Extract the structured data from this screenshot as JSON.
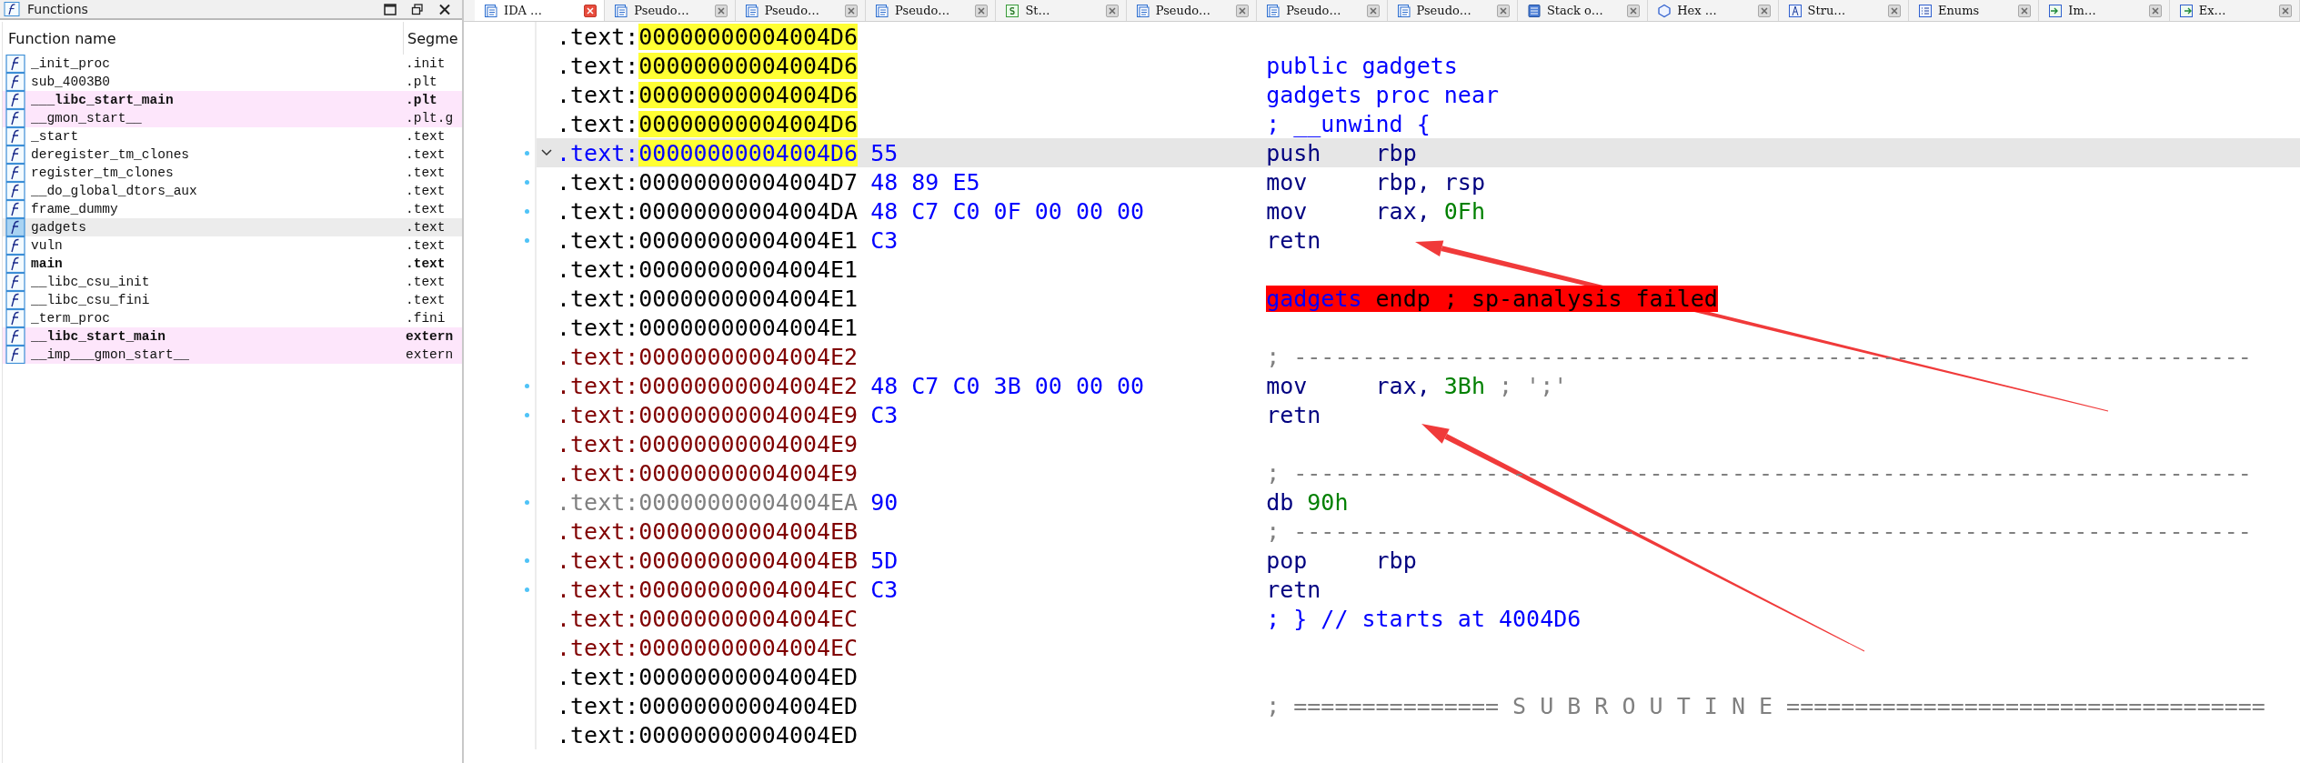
{
  "functions_panel": {
    "title": "Functions",
    "columns": [
      "Function name",
      "Segme"
    ],
    "rows": [
      {
        "name": "_init_proc",
        "segment": ".init",
        "bold": false,
        "library": false,
        "selected": false
      },
      {
        "name": "sub_4003B0",
        "segment": ".plt",
        "bold": false,
        "library": false,
        "selected": false
      },
      {
        "name": "___libc_start_main",
        "segment": ".plt",
        "bold": true,
        "library": true,
        "selected": false
      },
      {
        "name": "__gmon_start__",
        "segment": ".plt.g",
        "bold": false,
        "library": true,
        "selected": false
      },
      {
        "name": "_start",
        "segment": ".text",
        "bold": false,
        "library": false,
        "selected": false
      },
      {
        "name": "deregister_tm_clones",
        "segment": ".text",
        "bold": false,
        "library": false,
        "selected": false
      },
      {
        "name": "register_tm_clones",
        "segment": ".text",
        "bold": false,
        "library": false,
        "selected": false
      },
      {
        "name": "__do_global_dtors_aux",
        "segment": ".text",
        "bold": false,
        "library": false,
        "selected": false
      },
      {
        "name": "frame_dummy",
        "segment": ".text",
        "bold": false,
        "library": false,
        "selected": false
      },
      {
        "name": "gadgets",
        "segment": ".text",
        "bold": false,
        "library": false,
        "selected": true
      },
      {
        "name": "vuln",
        "segment": ".text",
        "bold": false,
        "library": false,
        "selected": false
      },
      {
        "name": "main",
        "segment": ".text",
        "bold": true,
        "library": false,
        "selected": false
      },
      {
        "name": "__libc_csu_init",
        "segment": ".text",
        "bold": false,
        "library": false,
        "selected": false
      },
      {
        "name": "__libc_csu_fini",
        "segment": ".text",
        "bold": false,
        "library": false,
        "selected": false
      },
      {
        "name": "_term_proc",
        "segment": ".fini",
        "bold": false,
        "library": false,
        "selected": false
      },
      {
        "name": "__libc_start_main",
        "segment": "extern",
        "bold": true,
        "library": true,
        "selected": false
      },
      {
        "name": "__imp___gmon_start__",
        "segment": "extern",
        "bold": false,
        "library": true,
        "selected": false
      }
    ]
  },
  "tabs": [
    {
      "label": "IDA …",
      "kind": "disasm",
      "selected": true
    },
    {
      "label": "Pseudo…",
      "kind": "pseudo",
      "selected": false
    },
    {
      "label": "Pseudo…",
      "kind": "pseudo",
      "selected": false
    },
    {
      "label": "Pseudo…",
      "kind": "pseudo",
      "selected": false
    },
    {
      "label": "St…",
      "kind": "strings",
      "selected": false
    },
    {
      "label": "Pseudo…",
      "kind": "pseudo",
      "selected": false
    },
    {
      "label": "Pseudo…",
      "kind": "pseudo",
      "selected": false
    },
    {
      "label": "Pseudo…",
      "kind": "pseudo",
      "selected": false
    },
    {
      "label": "Stack o…",
      "kind": "stack",
      "selected": false
    },
    {
      "label": "Hex …",
      "kind": "hex",
      "selected": false
    },
    {
      "label": "Stru…",
      "kind": "struct",
      "selected": false
    },
    {
      "label": "Enums",
      "kind": "enum",
      "selected": false
    },
    {
      "label": "Im…",
      "kind": "import",
      "selected": false
    },
    {
      "label": "Ex…",
      "kind": "export",
      "selected": false
    }
  ],
  "listing": [
    {
      "segment": ".text:",
      "address": "00000000004004D6",
      "kind": "function",
      "highlight": true,
      "current": false,
      "marked": false,
      "collapsible": false
    },
    {
      "segment": ".text:",
      "address": "00000000004004D6",
      "kind": "function",
      "highlight": true,
      "current": false,
      "marked": false,
      "collapsible": false,
      "code": {
        "tokens": [
          {
            "text": "public gadgets",
            "kind": "name"
          }
        ]
      }
    },
    {
      "segment": ".text:",
      "address": "00000000004004D6",
      "kind": "function",
      "highlight": true,
      "current": false,
      "marked": false,
      "collapsible": false,
      "code": {
        "tokens": [
          {
            "text": "gadgets proc near",
            "kind": "name"
          }
        ]
      }
    },
    {
      "segment": ".text:",
      "address": "00000000004004D6",
      "kind": "function",
      "highlight": true,
      "current": false,
      "marked": false,
      "collapsible": false,
      "code": {
        "tokens": [
          {
            "text": "; __unwind {",
            "kind": "name"
          }
        ]
      }
    },
    {
      "segment": ".text:",
      "address": "00000000004004D6",
      "kind": "function",
      "highlight": true,
      "current": true,
      "marked": true,
      "collapsible": true,
      "bytes": "55",
      "code": {
        "mnemonic": "push",
        "tokens": [
          {
            "text": "rbp",
            "kind": "operand"
          }
        ]
      }
    },
    {
      "segment": ".text:",
      "address": "00000000004004D7",
      "kind": "function",
      "highlight": false,
      "current": false,
      "marked": true,
      "collapsible": false,
      "bytes": "48 89 E5",
      "code": {
        "mnemonic": "mov",
        "tokens": [
          {
            "text": "rbp, rsp",
            "kind": "operand"
          }
        ]
      }
    },
    {
      "segment": ".text:",
      "address": "00000000004004DA",
      "kind": "function",
      "highlight": false,
      "current": false,
      "marked": true,
      "collapsible": false,
      "bytes": "48 C7 C0 0F 00 00 00",
      "code": {
        "mnemonic": "mov",
        "tokens": [
          {
            "text": "rax, ",
            "kind": "operand"
          },
          {
            "text": "0Fh",
            "kind": "number"
          }
        ]
      }
    },
    {
      "segment": ".text:",
      "address": "00000000004004E1",
      "kind": "function",
      "highlight": false,
      "current": false,
      "marked": true,
      "collapsible": false,
      "bytes": "C3",
      "code": {
        "mnemonic": "retn"
      }
    },
    {
      "segment": ".text:",
      "address": "00000000004004E1",
      "kind": "function",
      "highlight": false,
      "current": false,
      "marked": false,
      "collapsible": false
    },
    {
      "segment": ".text:",
      "address": "00000000004004E1",
      "kind": "function",
      "highlight": false,
      "current": false,
      "marked": false,
      "collapsible": false,
      "code": {
        "error": true,
        "tokens": [
          {
            "text": "gadgets",
            "kind": "name"
          },
          {
            "text": " endp ; sp-analysis failed",
            "kind": "plain"
          }
        ]
      }
    },
    {
      "segment": ".text:",
      "address": "00000000004004E1",
      "kind": "function",
      "highlight": false,
      "current": false,
      "marked": false,
      "collapsible": false
    },
    {
      "segment": ".text:",
      "address": "00000000004004E2",
      "kind": "outside",
      "highlight": false,
      "current": false,
      "marked": false,
      "collapsible": false,
      "code": {
        "tokens": [
          {
            "text": "; ----------------------------------------------------------------------",
            "kind": "comment"
          }
        ]
      }
    },
    {
      "segment": ".text:",
      "address": "00000000004004E2",
      "kind": "outside",
      "highlight": false,
      "current": false,
      "marked": true,
      "collapsible": false,
      "bytes": "48 C7 C0 3B 00 00 00",
      "code": {
        "mnemonic": "mov",
        "tokens": [
          {
            "text": "rax, ",
            "kind": "operand"
          },
          {
            "text": "3Bh",
            "kind": "number"
          },
          {
            "text": " ; ';'",
            "kind": "comment"
          }
        ]
      }
    },
    {
      "segment": ".text:",
      "address": "00000000004004E9",
      "kind": "outside",
      "highlight": false,
      "current": false,
      "marked": true,
      "collapsible": false,
      "bytes": "C3",
      "code": {
        "mnemonic": "retn"
      }
    },
    {
      "segment": ".text:",
      "address": "00000000004004E9",
      "kind": "outside",
      "highlight": false,
      "current": false,
      "marked": false,
      "collapsible": false
    },
    {
      "segment": ".text:",
      "address": "00000000004004E9",
      "kind": "outside",
      "highlight": false,
      "current": false,
      "marked": false,
      "collapsible": false,
      "code": {
        "tokens": [
          {
            "text": "; ----------------------------------------------------------------------",
            "kind": "comment"
          }
        ]
      }
    },
    {
      "segment": ".text:",
      "address": "00000000004004EA",
      "kind": "data",
      "highlight": false,
      "current": false,
      "marked": true,
      "collapsible": false,
      "bytes": "90",
      "code": {
        "tokens": [
          {
            "text": "db ",
            "kind": "operand"
          },
          {
            "text": "90h",
            "kind": "number"
          }
        ]
      }
    },
    {
      "segment": ".text:",
      "address": "00000000004004EB",
      "kind": "outside",
      "highlight": false,
      "current": false,
      "marked": false,
      "collapsible": false,
      "code": {
        "tokens": [
          {
            "text": "; ----------------------------------------------------------------------",
            "kind": "comment"
          }
        ]
      }
    },
    {
      "segment": ".text:",
      "address": "00000000004004EB",
      "kind": "outside",
      "highlight": false,
      "current": false,
      "marked": true,
      "collapsible": false,
      "bytes": "5D",
      "code": {
        "mnemonic": "pop",
        "tokens": [
          {
            "text": "rbp",
            "kind": "operand"
          }
        ]
      }
    },
    {
      "segment": ".text:",
      "address": "00000000004004EC",
      "kind": "outside",
      "highlight": false,
      "current": false,
      "marked": true,
      "collapsible": false,
      "bytes": "C3",
      "code": {
        "mnemonic": "retn"
      }
    },
    {
      "segment": ".text:",
      "address": "00000000004004EC",
      "kind": "outside",
      "highlight": false,
      "current": false,
      "marked": false,
      "collapsible": false,
      "code": {
        "tokens": [
          {
            "text": "; } // starts at 4004D6",
            "kind": "name"
          }
        ]
      }
    },
    {
      "segment": ".text:",
      "address": "00000000004004EC",
      "kind": "outside",
      "highlight": false,
      "current": false,
      "marked": false,
      "collapsible": false
    },
    {
      "segment": ".text:",
      "address": "00000000004004ED",
      "kind": "function",
      "highlight": false,
      "current": false,
      "marked": false,
      "collapsible": false
    },
    {
      "segment": ".text:",
      "address": "00000000004004ED",
      "kind": "function",
      "highlight": false,
      "current": false,
      "marked": false,
      "collapsible": false,
      "code": {
        "tokens": [
          {
            "text": "; =============== S U B R O U T I N E ===================================",
            "kind": "comment"
          }
        ]
      }
    },
    {
      "segment": ".text:",
      "address": "00000000004004ED",
      "kind": "function",
      "highlight": false,
      "current": false,
      "marked": false,
      "collapsible": false
    }
  ]
}
